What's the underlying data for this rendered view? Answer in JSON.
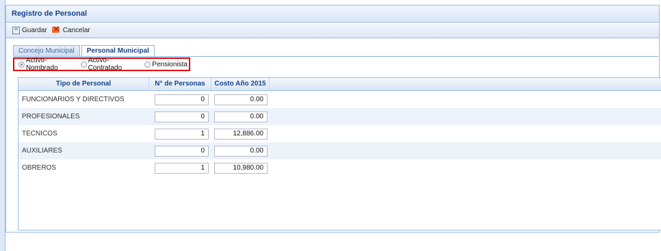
{
  "window": {
    "title": "Registro de Personal"
  },
  "toolbar": {
    "save_label": "Guardar",
    "cancel_label": "Cancelar"
  },
  "tabs": [
    {
      "label": "Concejo Municipal",
      "active": false
    },
    {
      "label": "Personal Municipal",
      "active": true
    }
  ],
  "radio_group": {
    "options": [
      {
        "label": "Activo-Nombrado",
        "checked": true
      },
      {
        "label": "Activo-Contratado",
        "checked": false
      },
      {
        "label": "Pensionista",
        "checked": false
      }
    ],
    "highlight_color": "#e00000"
  },
  "grid": {
    "columns": [
      "Tipo de Personal",
      "N° de Personas",
      "Costo Año 2015"
    ],
    "rows": [
      {
        "tipo": "FUNCIONARIOS Y DIRECTIVOS",
        "personas": "0",
        "costo": "0.00"
      },
      {
        "tipo": "PROFESIONALES",
        "personas": "0",
        "costo": "0.00"
      },
      {
        "tipo": "TECNICOS",
        "personas": "1",
        "costo": "12,886.00"
      },
      {
        "tipo": "AUXILIARES",
        "personas": "0",
        "costo": "0.00"
      },
      {
        "tipo": "OBREROS",
        "personas": "1",
        "costo": "10,980.00"
      }
    ]
  },
  "colors": {
    "header_text": "#15428b",
    "border": "#99bbe8"
  },
  "icons": {
    "save": "save-icon",
    "cancel": "cancel-icon"
  }
}
